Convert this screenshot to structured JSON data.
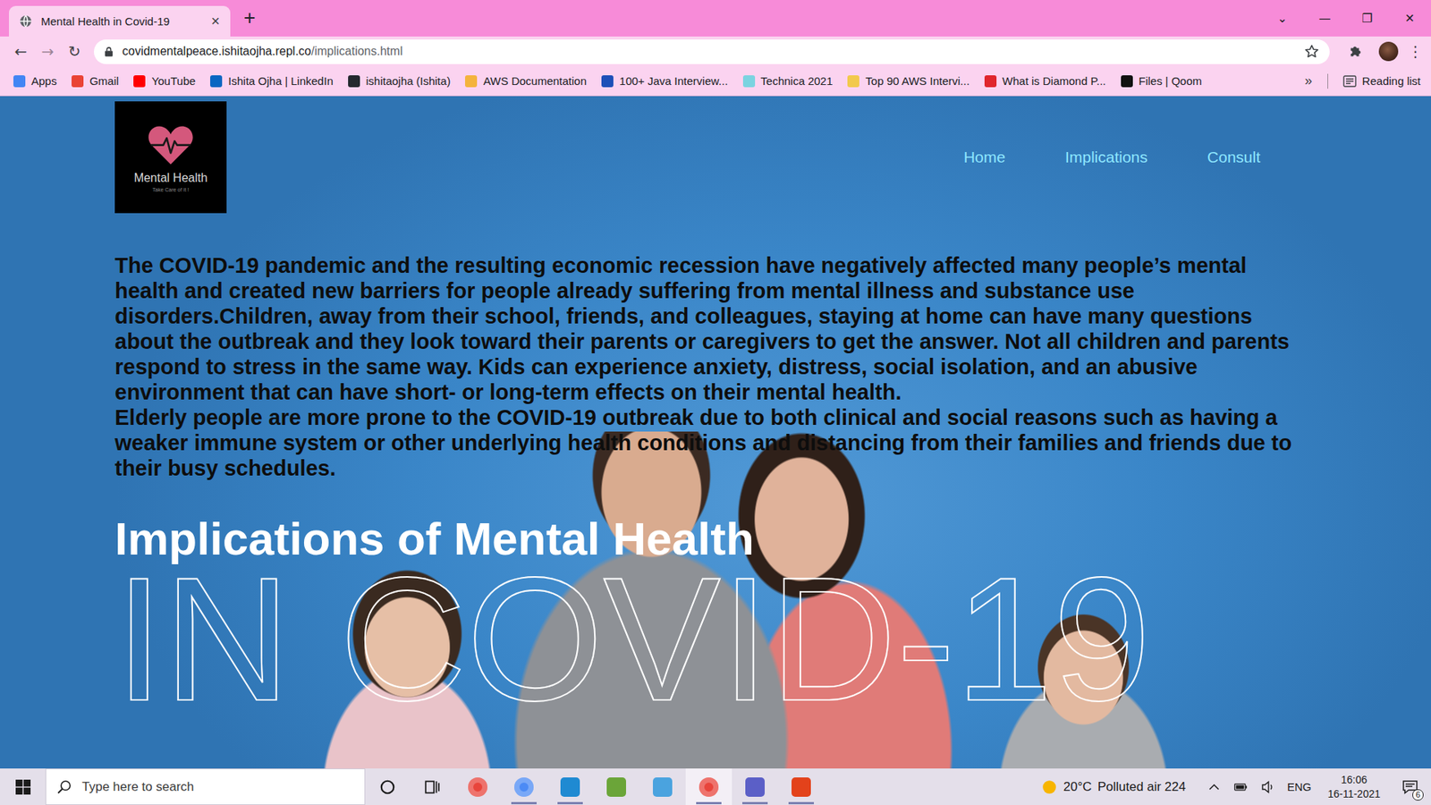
{
  "browser": {
    "tabs": [
      {
        "title": "Mental Health in Covid-19",
        "close": "×",
        "selected": true
      }
    ],
    "new_tab": "+",
    "window_controls": [
      "⌄",
      "—",
      "❐",
      "✕"
    ],
    "nav_buttons": [
      {
        "glyph": "←",
        "disabled": false
      },
      {
        "glyph": "→",
        "disabled": true
      },
      {
        "glyph": "↻",
        "disabled": false
      }
    ],
    "address": {
      "host": "covidmentalpeace.ishitaojha.repl.co",
      "path": "/implications.html"
    },
    "menu": "⋮",
    "bookmarks": [
      {
        "label": "Apps",
        "color": "#4285f4"
      },
      {
        "label": "Gmail",
        "color": "#ea4335"
      },
      {
        "label": "YouTube",
        "color": "#ff0000"
      },
      {
        "label": "Ishita Ojha | LinkedIn",
        "color": "#0a66c2"
      },
      {
        "label": "ishitaojha (Ishita)",
        "color": "#24292f"
      },
      {
        "label": "AWS Documentation",
        "color": "#f4b33d"
      },
      {
        "label": "100+ Java Interview...",
        "color": "#1d4fb8"
      },
      {
        "label": "Technica 2021",
        "color": "#7ad3e0"
      },
      {
        "label": "Top 90 AWS Intervi...",
        "color": "#f2c94c"
      },
      {
        "label": "What is Diamond P...",
        "color": "#e0262d"
      },
      {
        "label": "Files | Qoom",
        "color": "#111111"
      }
    ],
    "bookmarks_overflow": "»",
    "reading_list": "Reading list"
  },
  "page": {
    "logo": {
      "title": "Mental Health",
      "tagline": "Take Care of it !"
    },
    "nav": [
      "Home",
      "Implications",
      "Consult"
    ],
    "paragraphs": [
      "The COVID-19 pandemic and the resulting economic recession have negatively affected many people’s mental health and created new barriers for people already suffering from mental illness and substance use disorders.Children, away from their school, friends, and colleagues, staying at home can have many questions about the outbreak and they look toward their parents or caregivers to get the answer. Not all children and parents respond to stress in the same way. Kids can experience anxiety, distress, social isolation, and an abusive environment that can have short- or long-term effects on their mental health.",
      "Elderly people are more prone to the COVID-19 outbreak due to both clinical and social reasons such as having a weaker immune system or other underlying health conditions and distancing from their families and friends due to their busy schedules."
    ],
    "heading": "Implications of Mental Health",
    "outline_heading": "IN COVID-19"
  },
  "taskbar": {
    "search_placeholder": "Type here to search",
    "apps": [
      {
        "kind": "circle",
        "color": "#e8453c",
        "running": false,
        "selected": false
      },
      {
        "kind": "circle",
        "color": "#4c8bf5",
        "running": true,
        "selected": false
      },
      {
        "kind": "square",
        "color": "#1f8ad2",
        "running": true,
        "selected": false
      },
      {
        "kind": "square",
        "color": "#6ba539",
        "running": false,
        "selected": false
      },
      {
        "kind": "square",
        "color": "#4aa3df",
        "running": false,
        "selected": false
      },
      {
        "kind": "circle",
        "color": "#e8453c",
        "running": true,
        "selected": true
      },
      {
        "kind": "square",
        "color": "#5b5fc7",
        "running": true,
        "selected": false
      },
      {
        "kind": "square",
        "color": "#e3421b",
        "running": true,
        "selected": false
      }
    ],
    "weather": {
      "temperature": "20°C",
      "air": "Polluted air 224"
    },
    "language": "ENG",
    "time": "16:06",
    "date": "16-11-2021",
    "notifications": "6"
  }
}
